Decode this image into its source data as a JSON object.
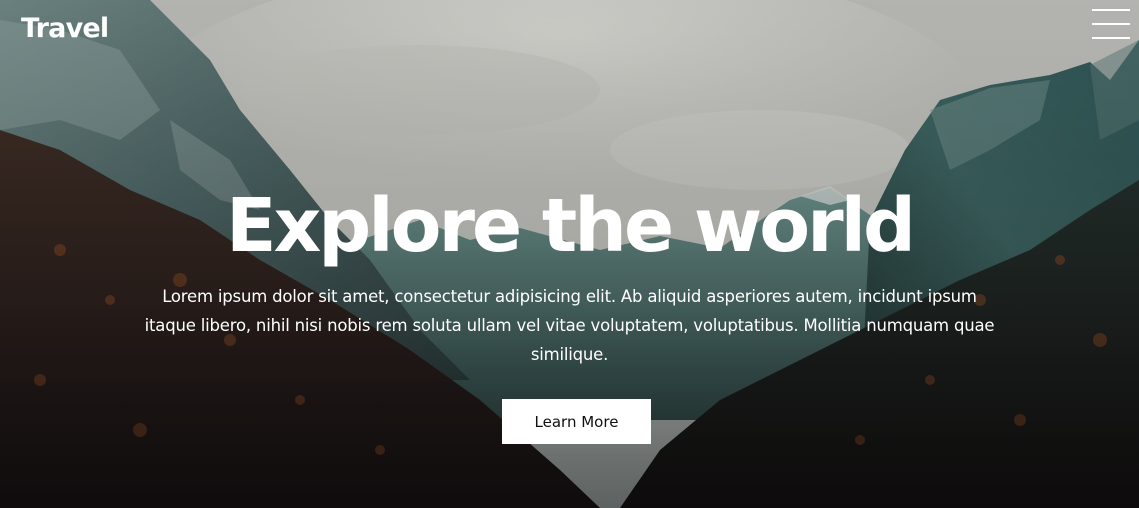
{
  "brand": {
    "logo_text": "Travel"
  },
  "nav": {
    "menu_icon": "hamburger-menu-icon"
  },
  "hero": {
    "background": "mountain-valley-photo",
    "title": "Explore the world",
    "text": "Lorem ipsum dolor sit amet, consectetur adipisicing elit. Ab aliquid asperiores autem, incidunt ipsum itaque libero, nihil nisi nobis rem soluta ullam vel vitae voluptatem, voluptatibus. Mollitia numquam quae similique.",
    "cta_label": "Learn More"
  },
  "colors": {
    "text": "#ffffff",
    "button_bg": "#ffffff",
    "button_text": "#111111"
  }
}
